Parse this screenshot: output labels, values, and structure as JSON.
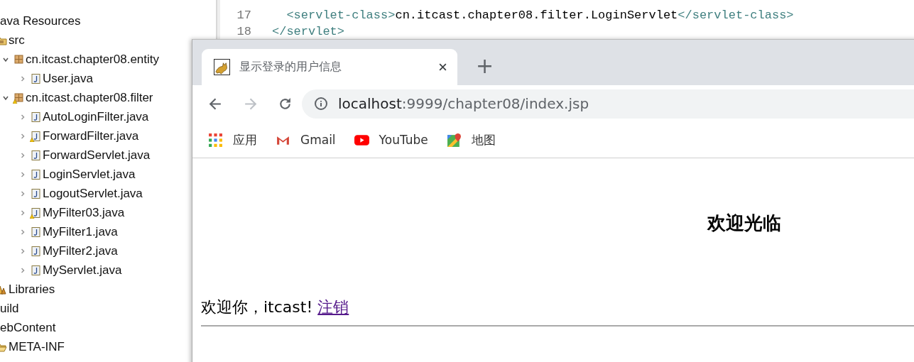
{
  "explorer": {
    "items": [
      {
        "label": "ava Resources",
        "children": [
          {
            "label": "src",
            "kind": "source-folder",
            "children": [
              {
                "label": "cn.itcast.chapter08.entity",
                "kind": "package",
                "expanded": true,
                "children": [
                  {
                    "label": "User.java",
                    "kind": "java",
                    "expanded": false
                  }
                ]
              },
              {
                "label": "cn.itcast.chapter08.filter",
                "kind": "package-warning",
                "expanded": true,
                "children": [
                  {
                    "label": "AutoLoginFilter.java",
                    "kind": "java",
                    "expanded": false
                  },
                  {
                    "label": "ForwardFilter.java",
                    "kind": "java-warning",
                    "expanded": false
                  },
                  {
                    "label": "ForwardServlet.java",
                    "kind": "java",
                    "expanded": false
                  },
                  {
                    "label": "LoginServlet.java",
                    "kind": "java",
                    "expanded": false
                  },
                  {
                    "label": "LogoutServlet.java",
                    "kind": "java",
                    "expanded": false
                  },
                  {
                    "label": "MyFilter03.java",
                    "kind": "java-warning",
                    "expanded": false
                  },
                  {
                    "label": "MyFilter1.java",
                    "kind": "java",
                    "expanded": false
                  },
                  {
                    "label": "MyFilter2.java",
                    "kind": "java",
                    "expanded": false
                  },
                  {
                    "label": "MyServlet.java",
                    "kind": "java",
                    "expanded": false
                  }
                ]
              }
            ]
          },
          {
            "label": "Libraries",
            "kind": "libraries"
          }
        ]
      },
      {
        "label": "uild"
      },
      {
        "label": "ebContent",
        "children": [
          {
            "label": "META-INF",
            "kind": "open-folder"
          }
        ]
      }
    ]
  },
  "editor": {
    "lines": [
      {
        "number": "17",
        "parts": [
          {
            "kind": "tag",
            "text": "  <servlet-class>"
          },
          {
            "kind": "text",
            "text": "cn.itcast.chapter08.filter.LoginServlet"
          },
          {
            "kind": "tag",
            "text": "</servlet-class>"
          }
        ]
      },
      {
        "number": "18",
        "parts": [
          {
            "kind": "tag",
            "text": "</servlet>"
          }
        ]
      }
    ]
  },
  "browser": {
    "tabs": [
      {
        "title": "显示登录的用户信息",
        "selected": true
      }
    ],
    "new_tab": "+",
    "address": {
      "host": "localhost",
      "rest": ":9999/chapter08/index.jsp"
    },
    "bookmarks": [
      {
        "label": "应用",
        "kind": "apps"
      },
      {
        "label": "Gmail",
        "kind": "mail"
      },
      {
        "label": "YouTube",
        "kind": "video"
      },
      {
        "label": "地图",
        "kind": "maps"
      }
    ],
    "page": {
      "heading": "欢迎光临",
      "greeting": "欢迎你，itcast!",
      "link": "注销"
    }
  }
}
